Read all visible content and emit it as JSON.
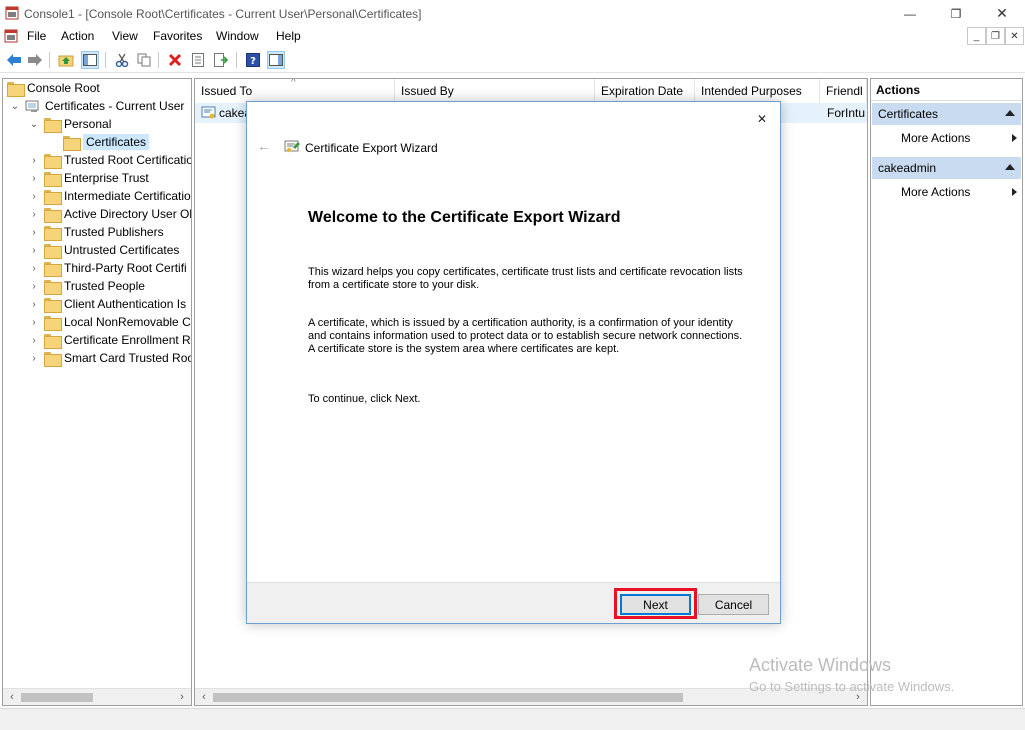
{
  "window": {
    "title": "Console1 - [Console Root\\Certificates - Current User\\Personal\\Certificates]",
    "minimize": "—",
    "restore": "❐",
    "close": "✕"
  },
  "menubar": {
    "items": [
      "File",
      "Action",
      "View",
      "Favorites",
      "Window",
      "Help"
    ],
    "mdi_minimize": "_",
    "mdi_restore": "❐",
    "mdi_close": "✕"
  },
  "tree": {
    "root": "Console Root",
    "store": "Certificates - Current User",
    "personal": "Personal",
    "certificates": "Certificates",
    "nodes": [
      "Trusted Root Certificatio",
      "Enterprise Trust",
      "Intermediate Certificatio",
      "Active Directory User Ol",
      "Trusted Publishers",
      "Untrusted Certificates",
      "Third-Party Root Certifi",
      "Trusted People",
      "Client Authentication Is",
      "Local NonRemovable C",
      "Certificate Enrollment R",
      "Smart Card Trusted Roo"
    ]
  },
  "list": {
    "columns": [
      "Issued To",
      "Issued By",
      "Expiration Date",
      "Intended Purposes",
      "Friendl"
    ],
    "row": {
      "issued_to": "cakea",
      "friendly": "ForIntu"
    }
  },
  "actions": {
    "title": "Actions",
    "sections": [
      {
        "name": "Certificates",
        "item": "More Actions"
      },
      {
        "name": "cakeadmin",
        "item": "More Actions"
      }
    ]
  },
  "dialog": {
    "title": "Certificate Export Wizard",
    "heading": "Welcome to the Certificate Export Wizard",
    "p1": "This wizard helps you copy certificates, certificate trust lists and certificate revocation lists from a certificate store to your disk.",
    "p2": "A certificate, which is issued by a certification authority, is a confirmation of your identity and contains information used to protect data or to establish secure network connections. A certificate store is the system area where certificates are kept.",
    "p3": "To continue, click Next.",
    "next": "Next",
    "cancel": "Cancel",
    "close": "✕",
    "back": "←"
  },
  "watermark": {
    "line1": "Activate Windows",
    "line2": "Go to Settings to activate Windows."
  },
  "colors": {
    "selection": "#cce8ff",
    "actions_section": "#c9dbf0",
    "highlight": "#e81123",
    "primary_border": "#0078d7"
  }
}
